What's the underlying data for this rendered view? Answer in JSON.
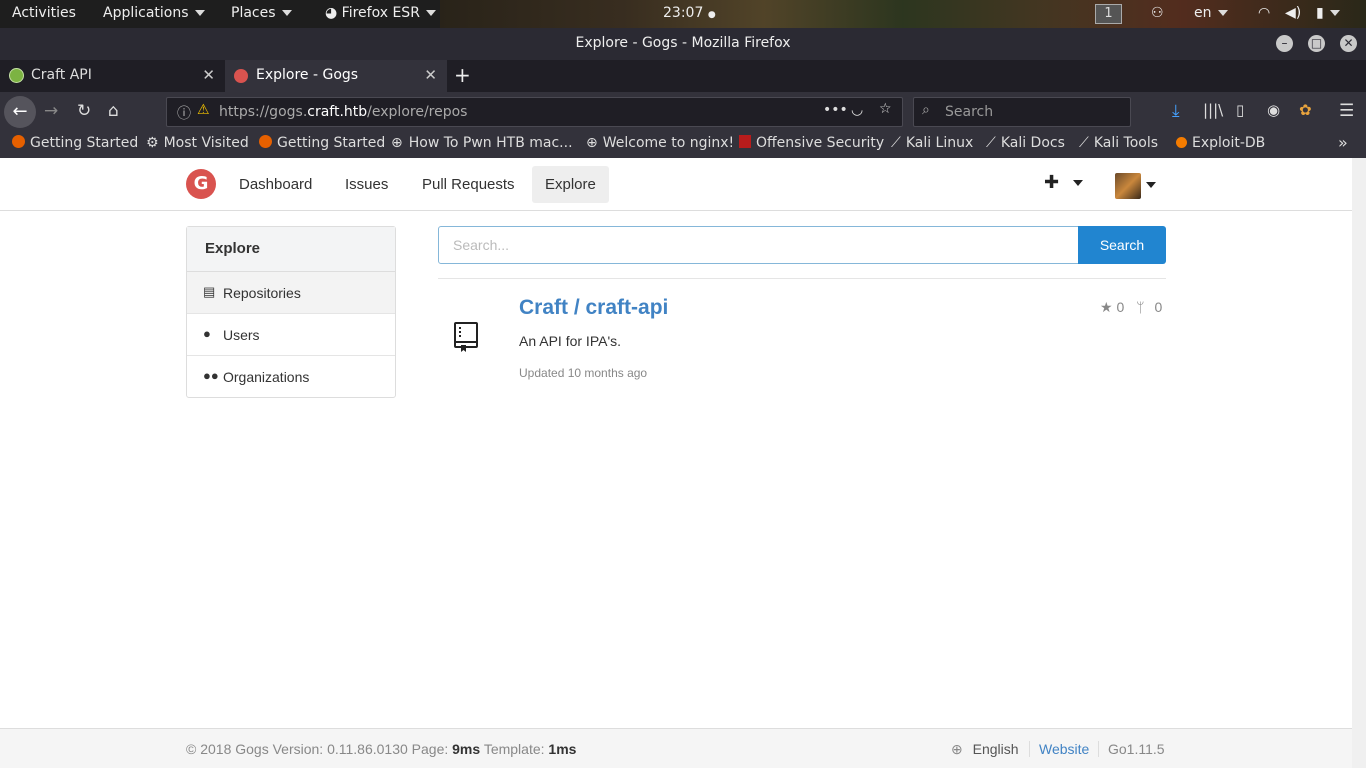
{
  "topbar": {
    "activities": "Activities",
    "applications": "Applications",
    "places": "Places",
    "firefox": "Firefox ESR",
    "clock": "23:07",
    "workspace": "1",
    "lang": "en"
  },
  "window": {
    "title": "Explore - Gogs - Mozilla Firefox"
  },
  "tabs": [
    {
      "label": "Craft API"
    },
    {
      "label": "Explore - Gogs"
    }
  ],
  "nav": {
    "url_prefix": "https://gogs.",
    "url_host": "craft.htb",
    "url_path": "/explore/repos",
    "search_placeholder": "Search"
  },
  "bookmarks": [
    {
      "label": "Getting Started"
    },
    {
      "label": "Most Visited"
    },
    {
      "label": "Getting Started"
    },
    {
      "label": "How To Pwn HTB mac..."
    },
    {
      "label": "Welcome to nginx!"
    },
    {
      "label": "Offensive Security"
    },
    {
      "label": "Kali Linux"
    },
    {
      "label": "Kali Docs"
    },
    {
      "label": "Kali Tools"
    },
    {
      "label": "Exploit-DB"
    }
  ],
  "header": {
    "nav": [
      "Dashboard",
      "Issues",
      "Pull Requests",
      "Explore"
    ]
  },
  "sidebar": {
    "title": "Explore",
    "items": [
      "Repositories",
      "Users",
      "Organizations"
    ]
  },
  "search": {
    "placeholder": "Search...",
    "button": "Search"
  },
  "repo": {
    "name": "Craft / craft-api",
    "description": "An API for IPA's.",
    "updated": "Updated 10 months ago",
    "stars": "0",
    "forks": "0"
  },
  "footer": {
    "copyright": "© 2018 Gogs Version: 0.11.86.0130 Page:",
    "page_time": "9ms",
    "template_label": "Template:",
    "template_time": "1ms",
    "language": "English",
    "website": "Website",
    "go_version": "Go1.11.5"
  },
  "colors": {
    "accent": "#2185d0",
    "link": "#4183c4",
    "logo": "#d9534f"
  }
}
